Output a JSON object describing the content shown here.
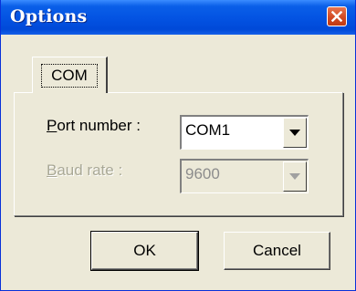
{
  "window": {
    "title": "Options"
  },
  "tabs": [
    {
      "label": "COM",
      "selected": true
    }
  ],
  "port": {
    "label_accel": "P",
    "label_rest": "ort number :",
    "value": "COM1",
    "enabled": true
  },
  "baud": {
    "label_accel": "B",
    "label_rest": "aud rate :",
    "value": "9600",
    "enabled": false
  },
  "buttons": {
    "ok": "OK",
    "cancel": "Cancel"
  },
  "colors": {
    "titlebar": "#0454e3",
    "dialog_face": "#ece9d8",
    "close_button": "#d24a24",
    "disabled_text": "#a9a896"
  },
  "icons": {
    "close": "close-icon",
    "dropdown": "chevron-down-icon"
  }
}
